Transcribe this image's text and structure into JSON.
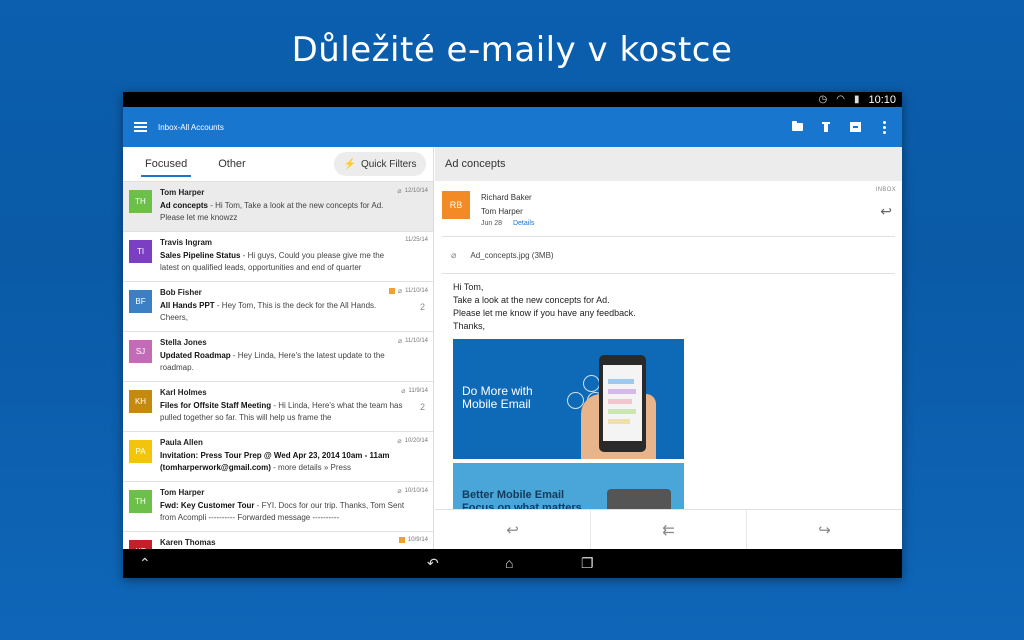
{
  "headline": "Důležité e-maily v kostce",
  "status": {
    "time": "10:10"
  },
  "appbar": {
    "title": "Inbox-All Accounts"
  },
  "tabs": {
    "focused": "Focused",
    "other": "Other",
    "quick_filters": "Quick Filters"
  },
  "messages": [
    {
      "initials": "TH",
      "color": "#6cc04a",
      "sender": "Tom Harper",
      "subject": "Ad concepts",
      "preview": " - Hi Tom, Take a look at the new concepts for Ad. Please let me knowzz",
      "date": "12/10/14",
      "attachment": true,
      "flag": false,
      "count": "",
      "selected": true
    },
    {
      "initials": "TI",
      "color": "#7b3fc4",
      "sender": "Travis Ingram",
      "subject": "Sales Pipeline Status",
      "preview": " - Hi guys, Could you please give me the latest on qualified leads, opportunities and end of quarter",
      "date": "11/25/14",
      "attachment": false,
      "flag": false,
      "count": "",
      "selected": false
    },
    {
      "initials": "BF",
      "color": "#3b7fc4",
      "sender": "Bob Fisher",
      "subject": "All Hands PPT",
      "preview": " - Hey Tom, This is the deck for the All Hands. Cheers,",
      "date": "11/10/14",
      "attachment": true,
      "flag": true,
      "count": "2",
      "selected": false
    },
    {
      "initials": "SJ",
      "color": "#c46bb8",
      "sender": "Stella Jones",
      "subject": "Updated Roadmap",
      "preview": " - Hey Linda, Here's the latest update to the roadmap.",
      "date": "11/10/14",
      "attachment": true,
      "flag": false,
      "count": "",
      "selected": false
    },
    {
      "initials": "KH",
      "color": "#c48a10",
      "sender": "Karl Holmes",
      "subject": "Files for Offsite Staff Meeting",
      "preview": " - Hi Linda, Here's what the team has pulled together so far. This will help us frame the",
      "date": "11/9/14",
      "attachment": true,
      "flag": false,
      "count": "2",
      "selected": false
    },
    {
      "initials": "PA",
      "color": "#f2c40c",
      "sender": "Paula Allen",
      "subject": "Invitation: Press Tour Prep @ Wed Apr 23, 2014 10am - 11am (tomharperwork@gmail.com)",
      "preview": " - more details » Press",
      "date": "10/20/14",
      "attachment": true,
      "flag": false,
      "count": "",
      "selected": false
    },
    {
      "initials": "TH",
      "color": "#6cc04a",
      "sender": "Tom Harper",
      "subject": "Fwd: Key Customer Tour",
      "preview": " - FYI. Docs for our trip. Thanks, Tom Sent from Acompli ---------- Forwarded message ----------",
      "date": "10/10/14",
      "attachment": true,
      "flag": false,
      "count": "",
      "selected": false
    },
    {
      "initials": "KT",
      "color": "#c4202a",
      "sender": "Karen Thomas",
      "subject": "",
      "preview": "",
      "date": "10/9/14",
      "attachment": false,
      "flag": true,
      "count": "",
      "selected": false
    }
  ],
  "reading": {
    "subject": "Ad concepts",
    "badge": "INBOX",
    "avatar": "RB",
    "from": "Richard Baker",
    "to": "Tom Harper",
    "date": "Jun 28",
    "details": "Details",
    "attachment": "Ad_concepts.jpg (3MB)",
    "line1": "Hi Tom,",
    "line2": "Take a look at the new concepts for Ad.",
    "line3": "Please let me know if you have any feedback.",
    "line4": "Thanks,",
    "promo1_line1": "Do More with",
    "promo1_line2": "Mobile Email",
    "promo2_line1": "Better Mobile Email",
    "promo2_line2": "Focus on what matters"
  },
  "icons": {
    "reply": "↩",
    "reply_all": "⇇",
    "forward": "↪"
  }
}
